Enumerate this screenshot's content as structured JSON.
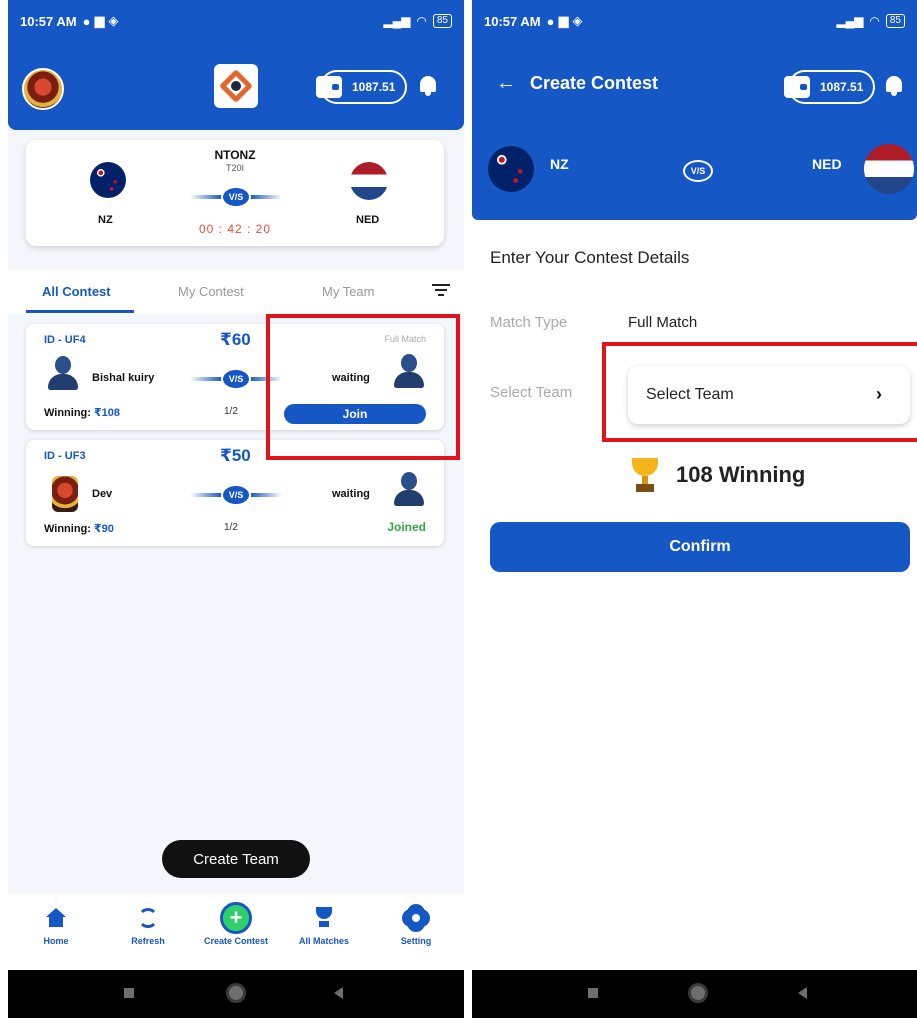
{
  "left": {
    "status": {
      "time": "10:57 AM",
      "battery": "85"
    },
    "wallet_balance": "1087.51",
    "match": {
      "series": "NTONZ",
      "format": "T20I",
      "team1": "NZ",
      "team2": "NED",
      "vs": "V/S",
      "timer": "00 : 42 : 20"
    },
    "tabs": [
      {
        "label": "All Contest",
        "active": true
      },
      {
        "label": "My Contest",
        "active": false
      },
      {
        "label": "My Team",
        "active": false
      }
    ],
    "contests": [
      {
        "id": "ID - UF4",
        "amount": "₹60",
        "type": "Full Match",
        "player": "Bishal kuiry",
        "opponent": "waiting",
        "winning_label": "Winning: ",
        "winning_amount": "₹108",
        "slots": "1/2",
        "action": "Join"
      },
      {
        "id": "ID - UF3",
        "amount": "₹50",
        "player": "Dev",
        "opponent": "waiting",
        "winning_label": "Winning: ",
        "winning_amount": "₹90",
        "slots": "1/2",
        "status": "Joined"
      }
    ],
    "create_team": "Create Team",
    "nav": [
      {
        "label": "Home",
        "icon": "home-icon"
      },
      {
        "label": "Refresh",
        "icon": "refresh-icon"
      },
      {
        "label": "Create Contest",
        "icon": "plus-circle-icon"
      },
      {
        "label": "All Matches",
        "icon": "trophy-icon"
      },
      {
        "label": "Setting",
        "icon": "gear-icon"
      }
    ]
  },
  "right": {
    "status": {
      "time": "10:57 AM",
      "battery": "85"
    },
    "title": "Create Contest",
    "wallet_balance": "1087.51",
    "team1": "NZ",
    "team2": "NED",
    "vs": "V/S",
    "form_heading": "Enter Your Contest Details",
    "match_type_label": "Match Type",
    "match_type_value": "Full Match",
    "select_team_label": "Select Team",
    "select_team_value": "Select Team",
    "winning": "108 Winning",
    "confirm": "Confirm"
  },
  "colors": {
    "primary": "#1557c4",
    "highlight": "#e3131b",
    "success": "#3aa44a",
    "timer": "#e2503a"
  }
}
